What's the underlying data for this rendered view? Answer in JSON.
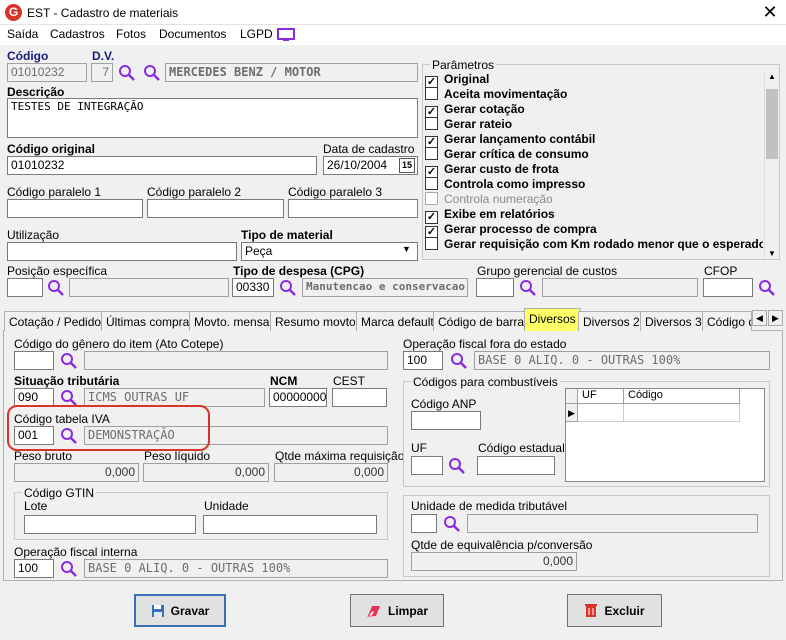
{
  "window": {
    "title": "EST - Cadastro de materiais"
  },
  "menu": [
    "Saída",
    "Cadastros",
    "Fotos",
    "Documentos",
    "LGPD"
  ],
  "header": {
    "codigo_label": "Código",
    "codigo_value": "01010232",
    "dv_label": "D.V.",
    "dv_value": "7",
    "material_name": "MERCEDES BENZ / MOTOR",
    "descricao_label": "Descrição",
    "descricao_value": "TESTES DE INTEGRAÇÃO",
    "codigo_original_label": "Código original",
    "codigo_original_value": "01010232",
    "data_cadastro_label": "Data de cadastro",
    "data_cadastro_value": "26/10/2004",
    "calendar_day": "15",
    "cod_paralelo1_label": "Código paralelo 1",
    "cod_paralelo2_label": "Código paralelo 2",
    "cod_paralelo3_label": "Código paralelo 3",
    "utilizacao_label": "Utilização",
    "tipo_material_label": "Tipo de material",
    "tipo_material_value": "Peça",
    "posicao_label": "Posição específica",
    "tipo_despesa_label": "Tipo de despesa (CPG)",
    "tipo_despesa_code": "00330",
    "tipo_despesa_desc": "Manutencao e conservacao",
    "grupo_gerencial_label": "Grupo gerencial de custos",
    "cfop_label": "CFOP"
  },
  "parametros": {
    "title": "Parâmetros",
    "items": [
      {
        "label": "Original",
        "checked": true,
        "disabled": false
      },
      {
        "label": "Aceita movimentação",
        "checked": false,
        "disabled": false
      },
      {
        "label": "Gerar cotação",
        "checked": true,
        "disabled": false
      },
      {
        "label": "Gerar rateio",
        "checked": false,
        "disabled": false
      },
      {
        "label": "Gerar lançamento contábil",
        "checked": true,
        "disabled": false
      },
      {
        "label": "Gerar crítica de consumo",
        "checked": false,
        "disabled": false
      },
      {
        "label": "Gerar custo de frota",
        "checked": true,
        "disabled": false
      },
      {
        "label": "Controla como impresso",
        "checked": false,
        "disabled": false
      },
      {
        "label": "Controla numeração",
        "checked": false,
        "disabled": true
      },
      {
        "label": "Exibe em relatórios",
        "checked": true,
        "disabled": false
      },
      {
        "label": "Gerar processo de compra",
        "checked": true,
        "disabled": false
      },
      {
        "label": "Gerar requisição com Km rodado menor que o esperado",
        "checked": false,
        "disabled": false
      }
    ]
  },
  "tabs": [
    "Cotação / Pedido",
    "Últimas compras",
    "Movto. mensal",
    "Resumo movto.",
    "Marca default",
    "Código de barras",
    "Diversos",
    "Diversos 2",
    "Diversos 3",
    "Código de"
  ],
  "diversos": {
    "genero_label": "Código do gênero do item (Ato Cotepe)",
    "situacao_label": "Situação tributária",
    "situacao_code": "090",
    "situacao_desc": "ICMS OUTRAS UF",
    "ncm_label": "NCM",
    "ncm_value": "00000000",
    "cest_label": "CEST",
    "iva_label": "Código tabela IVA",
    "iva_code": "001",
    "iva_desc": "DEMONSTRAÇÃO",
    "peso_bruto_label": "Peso bruto",
    "peso_bruto_value": "0,000",
    "peso_liquido_label": "Peso líquido",
    "peso_liquido_value": "0,000",
    "qtde_max_label": "Qtde máxima requisição",
    "qtde_max_value": "0,000",
    "gtin_title": "Código GTIN",
    "lote_label": "Lote",
    "unidade_label": "Unidade",
    "op_interna_label": "Operação fiscal interna",
    "op_interna_code": "100",
    "op_interna_desc": "BASE 0 ALIQ. 0 - OUTRAS 100%",
    "op_fora_label": "Operação fiscal fora do estado",
    "op_fora_code": "100",
    "op_fora_desc": "BASE 0 ALIQ. 0 - OUTRAS 100%",
    "combustiveis_title": "Códigos para combustíveis",
    "anp_label": "Código ANP",
    "uf_label": "UF",
    "cod_estadual_label": "Código estadual",
    "grid_uf": "UF",
    "grid_codigo": "Código",
    "un_trib_label": "Unidade de medida tributável",
    "qtde_equiv_label": "Qtde de equivalência p/conversão",
    "qtde_equiv_value": "0,000"
  },
  "buttons": {
    "gravar": "Gravar",
    "limpar": "Limpar",
    "excluir": "Excluir"
  },
  "colors": {
    "accent": "#8a2be2",
    "highlight_tab": "#ffff66",
    "annotation": "#d9342b"
  }
}
